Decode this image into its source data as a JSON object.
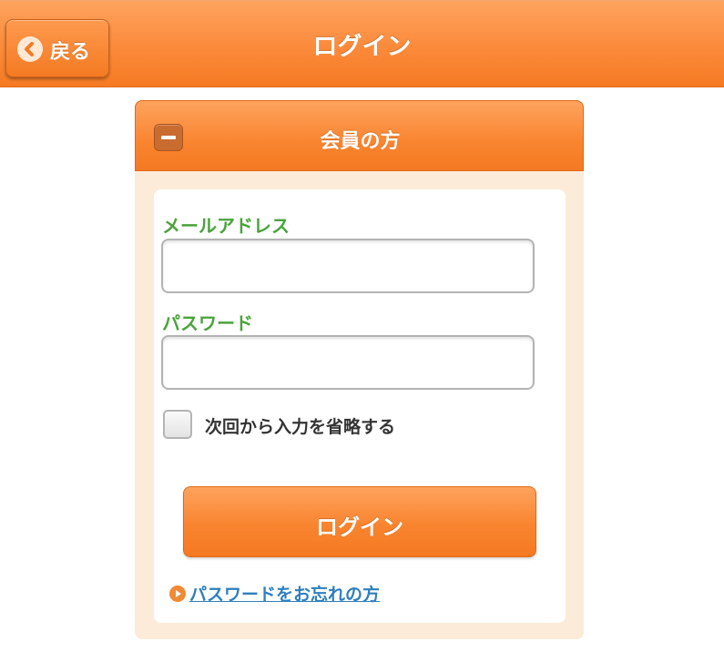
{
  "header": {
    "title": "ログイン",
    "back_label": "戻る",
    "back_icon": "chevron-left-icon"
  },
  "panel": {
    "title": "会員の方",
    "collapse_icon": "minus-icon",
    "email_label": "メールアドレス",
    "email_value": "",
    "password_label": "パスワード",
    "password_value": "",
    "remember_label": "次回から入力を省略する",
    "remember_checked": false,
    "login_button": "ログイン",
    "forgot_link": "パスワードをお忘れの方"
  },
  "colors": {
    "accent_orange": "#f9842f",
    "label_green": "#4aa33b",
    "link_blue": "#2e7fbe",
    "panel_bg": "#fdebd9"
  }
}
